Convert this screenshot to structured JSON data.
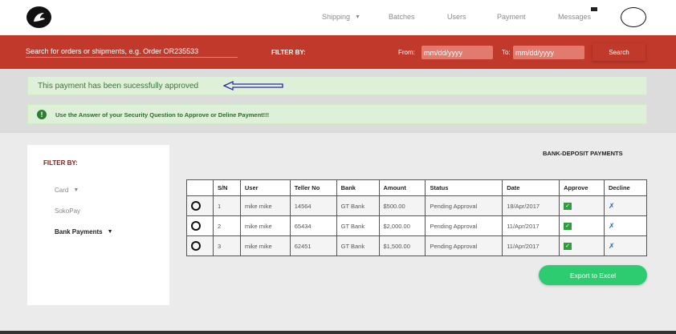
{
  "nav": {
    "items": [
      {
        "label": "Shipping",
        "has_caret": true
      },
      {
        "label": "Batches"
      },
      {
        "label": "Users"
      },
      {
        "label": "Payment"
      },
      {
        "label": "Messages"
      }
    ]
  },
  "filter_bar": {
    "search_placeholder": "Search for orders or shipments, e.g. Order OR235533",
    "filter_label": "FILTER BY:",
    "from_label": "From:",
    "to_label": "To:",
    "date_placeholder": "mm/dd/yyyy",
    "search_button": "Search"
  },
  "alerts": {
    "success": "This payment has been sucessfully approved",
    "info": "Use the Answer of your Security Question to Approve or Deline Payment!!!"
  },
  "sidebar": {
    "title": "FILTER BY:",
    "items": [
      {
        "label": "Card",
        "caret": true
      },
      {
        "label": "SokoPay"
      },
      {
        "label": "Bank Payments",
        "caret": true,
        "active": true
      }
    ]
  },
  "main": {
    "title": "BANK-DEPOSIT PAYMENTS",
    "columns": [
      "",
      "S/N",
      "User",
      "Teller No",
      "Bank",
      "Amount",
      "Status",
      "Date",
      "Approve",
      "Decline"
    ],
    "rows": [
      {
        "sn": "1",
        "user": "mike mike",
        "teller": "14564",
        "bank": "GT Bank",
        "amount": "$500.00",
        "status": "Pending Approval",
        "date": "18/Apr/2017"
      },
      {
        "sn": "2",
        "user": "mike mike",
        "teller": "65434",
        "bank": "GT Bank",
        "amount": "$2,000.00",
        "status": "Pending Approval",
        "date": "11/Apr/2017"
      },
      {
        "sn": "3",
        "user": "mike mike",
        "teller": "62451",
        "bank": "GT Bank",
        "amount": "$1,500.00",
        "status": "Pending Approval",
        "date": "11/Apr/2017"
      }
    ],
    "approve_glyph": "✓",
    "decline_glyph": "✗",
    "export_button": "Export to Excel"
  },
  "colors": {
    "brand_red": "#c0392b",
    "alert_green_bg": "#dff0d8",
    "export_green": "#2ecc71"
  }
}
